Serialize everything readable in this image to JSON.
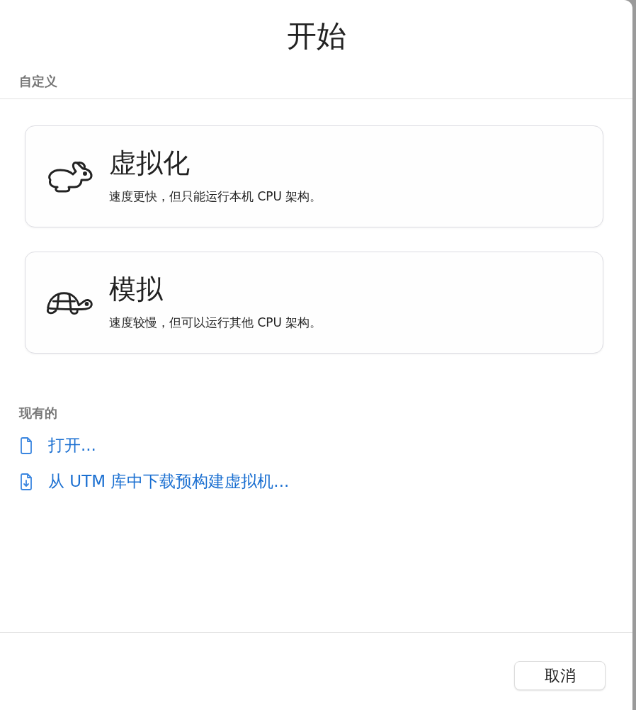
{
  "window": {
    "title": "开始"
  },
  "custom": {
    "heading": "自定义",
    "options": [
      {
        "kind": "rabbit",
        "title": "虚拟化",
        "description": "速度更快，但只能运行本机 CPU 架构。"
      },
      {
        "kind": "turtle",
        "title": "模拟",
        "description": "速度较慢，但可以运行其他 CPU 架构。"
      }
    ]
  },
  "existing": {
    "heading": "现有的",
    "links": [
      {
        "kind": "document",
        "label": "打开..."
      },
      {
        "kind": "download",
        "label": "从 UTM 库中下载预构建虚拟机..."
      }
    ]
  },
  "buttons": [
    {
      "label": "取消"
    }
  ]
}
